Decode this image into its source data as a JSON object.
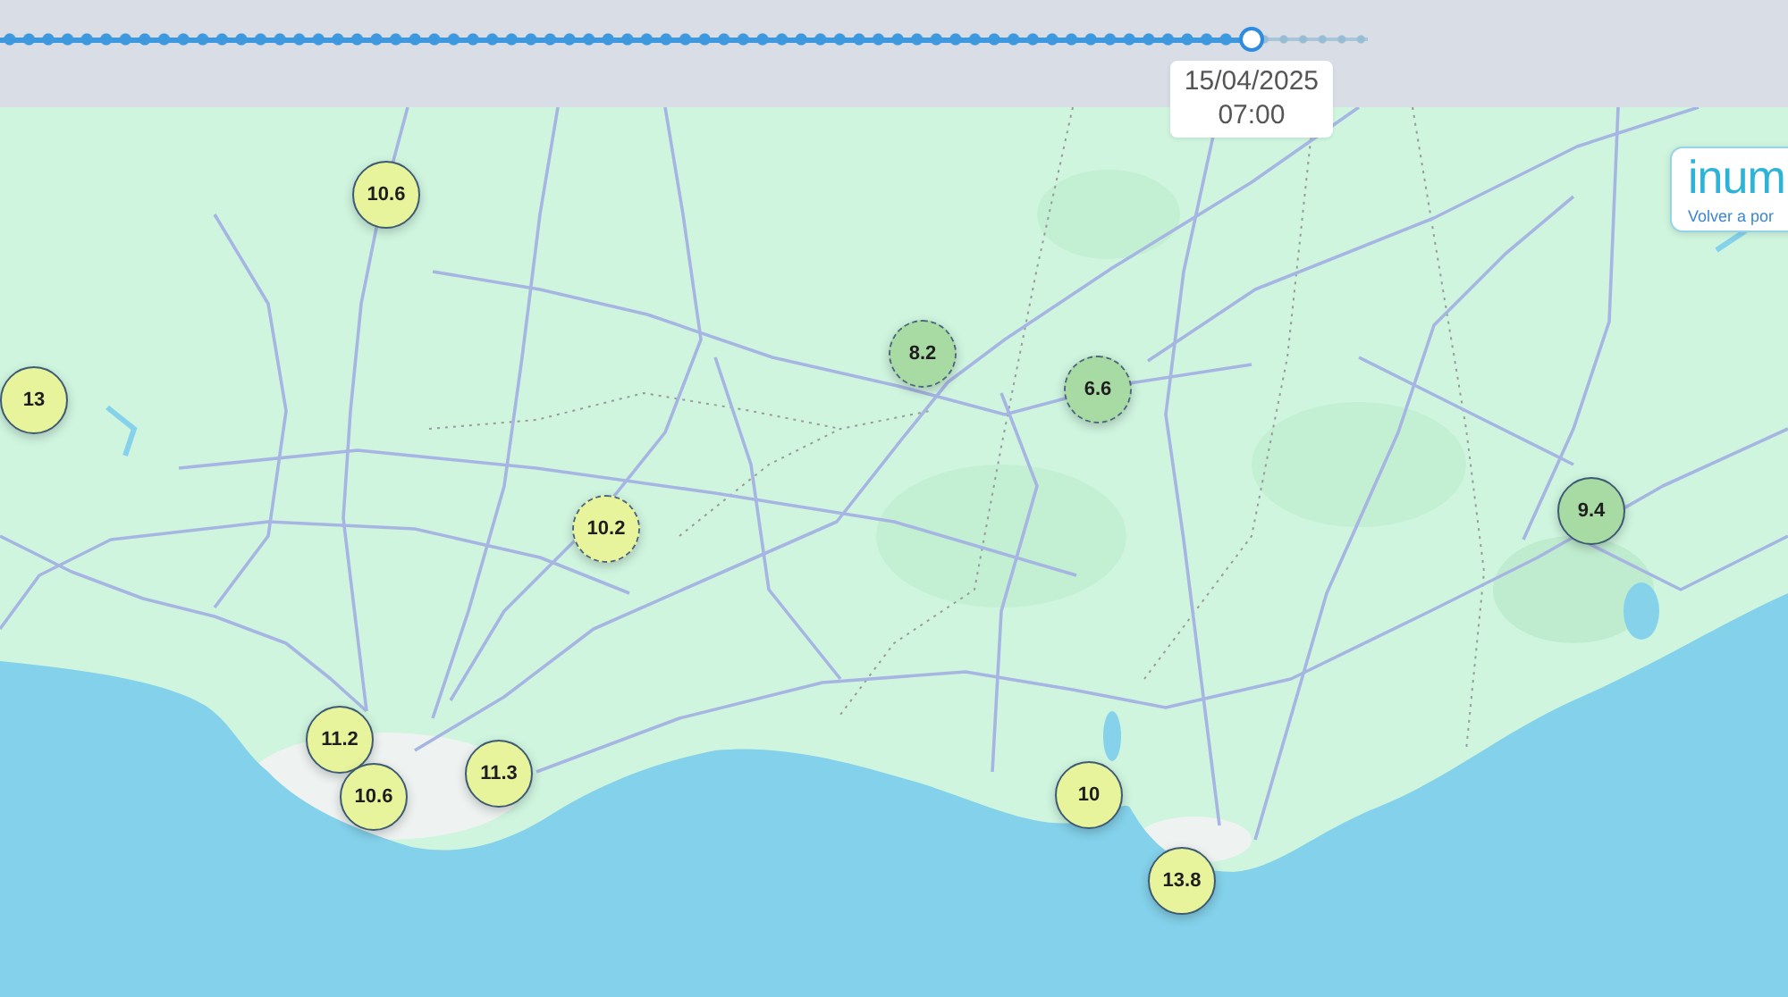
{
  "timeline": {
    "level": 0.915,
    "tooltip": {
      "date": "15/04/2025",
      "time": "07:00"
    }
  },
  "portal_link": {
    "brand": "inum",
    "label": "Volver a por"
  },
  "map": {
    "markers": [
      {
        "value": "10.6",
        "color": "#e8f49c",
        "kind": "solid"
      },
      {
        "value": "8.2",
        "color": "#a8dba3",
        "kind": "dashed"
      },
      {
        "value": "6.6",
        "color": "#a8dba3",
        "kind": "dashed"
      },
      {
        "value": "13",
        "color": "#e8f49c",
        "kind": "solid"
      },
      {
        "value": "9.4",
        "color": "#a8dba3",
        "kind": "solid"
      },
      {
        "value": "10.2",
        "color": "#e8f49c",
        "kind": "dashed"
      },
      {
        "value": "11.2",
        "color": "#e8f49c",
        "kind": "solid"
      },
      {
        "value": "11.3",
        "color": "#e8f49c",
        "kind": "solid"
      },
      {
        "value": "10",
        "color": "#e8f49c",
        "kind": "solid"
      },
      {
        "value": "10.6",
        "color": "#e8f49c",
        "kind": "solid"
      },
      {
        "value": "13.8",
        "color": "#e8f49c",
        "kind": "solid"
      }
    ]
  }
}
